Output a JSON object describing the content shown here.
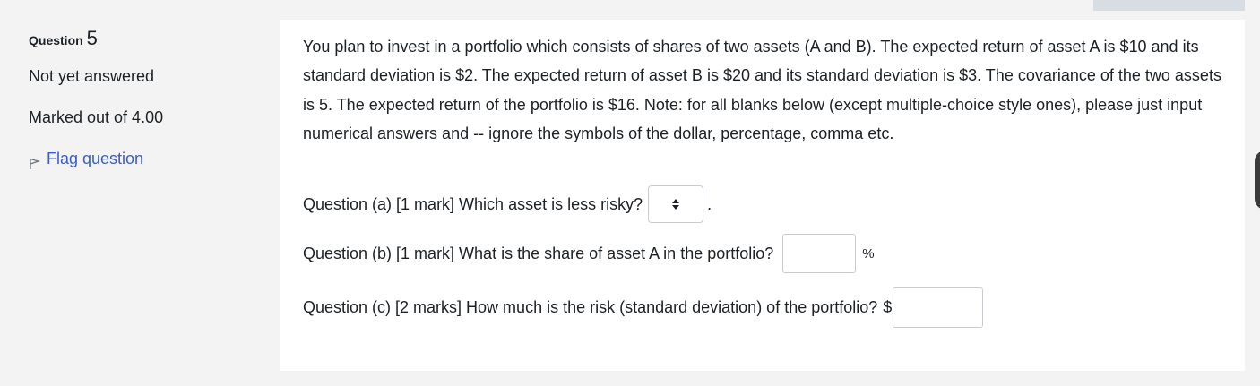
{
  "info": {
    "question_label": "Question",
    "question_number": "5",
    "state": "Not yet answered",
    "grade": "Marked out of 4.00",
    "flag_label": "Flag question"
  },
  "question": {
    "text": "You plan to invest in a portfolio which consists of shares of two assets (A and B).  The expected return of asset A is $10 and its standard deviation is $2. The expected return of asset B is $20 and its standard deviation is $3. The covariance of the two assets is 5. The expected return of the portfolio is $16. Note: for all blanks below (except multiple-choice style ones), please just input numerical answers and  -- ignore the symbols of the dollar, percentage, comma etc.",
    "sub_a": {
      "label": "Question (a) [1 mark]  Which asset is less risky?",
      "selected": "",
      "after": "."
    },
    "sub_b": {
      "label": "Question (b) [1 mark] What is the share of asset A in the portfolio?",
      "value": "",
      "unit": "%"
    },
    "sub_c": {
      "label": "Question (c) [2 marks] How much is the risk (standard deviation) of the portfolio?",
      "prefix": "$",
      "value": ""
    }
  },
  "icons": {
    "flag": "flag-icon",
    "select_arrows": "up-down-arrows-icon"
  },
  "colors": {
    "link": "#3b5bdb",
    "background": "#f3f3f3",
    "panel": "#ffffff"
  }
}
